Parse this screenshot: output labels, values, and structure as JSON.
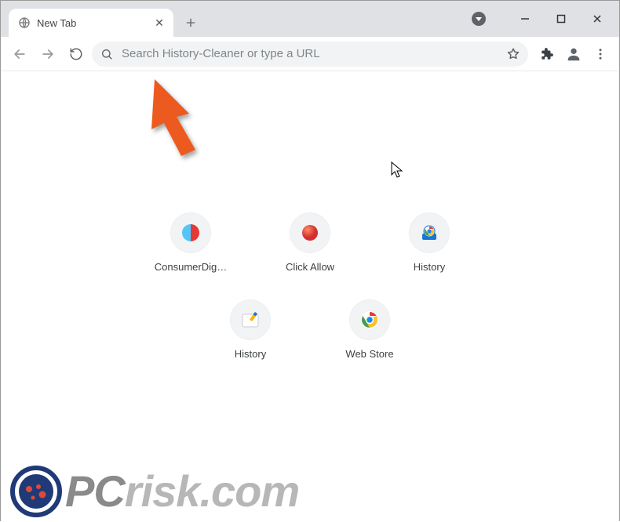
{
  "window": {
    "minimize": "–",
    "maximize": "☐",
    "close": "✕"
  },
  "tab": {
    "title": "New Tab",
    "close_tooltip": "Close"
  },
  "toolbar": {
    "search_placeholder": "Search History-Cleaner or type a URL"
  },
  "shortcuts": [
    {
      "label": "ConsumerDig…",
      "icon": "consumer"
    },
    {
      "label": "Click Allow",
      "icon": "red-dot"
    },
    {
      "label": "History",
      "icon": "chrome-blue"
    },
    {
      "label": "History",
      "icon": "brush"
    },
    {
      "label": "Web Store",
      "icon": "chrome"
    }
  ],
  "watermark": {
    "text_lead": "PC",
    "text_rest": "risk.com"
  },
  "colors": {
    "tabstrip": "#dfe1e5",
    "omnibox_bg": "#f1f3f4",
    "text": "#3c4043",
    "annotation": "#ec5a1f",
    "watermark": "#b7b7b7"
  }
}
